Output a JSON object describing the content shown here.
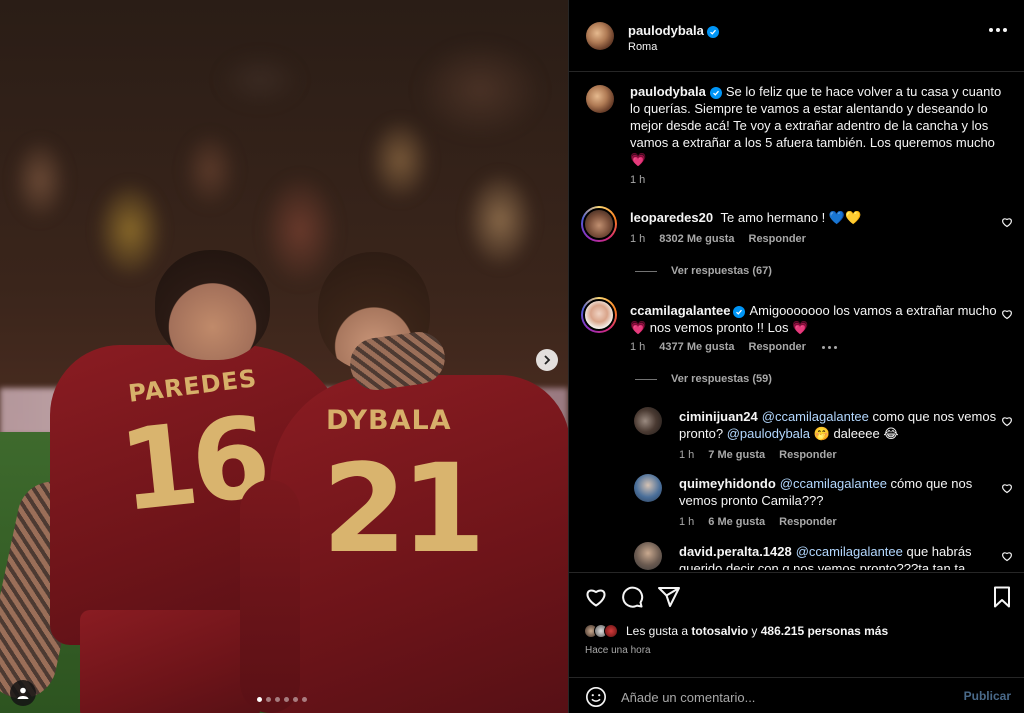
{
  "post": {
    "author": "paulodybala",
    "location": "Roma",
    "carousel": {
      "total": 6,
      "active": 1
    },
    "players": [
      {
        "name": "PAREDES",
        "number": "16"
      },
      {
        "name": "DYBALA",
        "number": "21"
      }
    ]
  },
  "caption": {
    "user": "paulodybala",
    "text": "Se lo feliz que te hace volver a tu casa y cuanto lo querías. Siempre te vamos a estar alentando y deseando lo mejor desde acá! Te voy a extrañar adentro de la cancha y los vamos a extrañar a los 5 afuera también. Los queremos mucho",
    "emoji": "💗",
    "time": "1 h"
  },
  "comments": [
    {
      "user": "leoparedes20",
      "text": "Te amo hermano !",
      "emoji": "💙💛",
      "time": "1 h",
      "likes": "8302 Me gusta",
      "reply_label": "Responder",
      "view_replies": "Ver respuestas (67)"
    },
    {
      "user": "ccamilagalantee",
      "text": "Amigooooooo los vamos a extrañar mucho",
      "text2_prefix": "💗",
      "text2": " nos vemos pronto !! Los ",
      "text2_suffix": "💗",
      "time": "1 h",
      "likes": "4377 Me gusta",
      "reply_label": "Responder",
      "view_replies": "Ver respuestas (59)"
    }
  ],
  "replies": [
    {
      "user": "ciminijuan24",
      "mention1": "@ccamilagalantee",
      "text1": " como que nos vemos",
      "text2": "pronto? ",
      "mention2": "@paulodybala",
      "text3": " 🤭 daleeee 😂",
      "time": "1 h",
      "likes": "7 Me gusta",
      "reply_label": "Responder"
    },
    {
      "user": "quimeyhidondo",
      "mention1": "@ccamilagalantee",
      "text1": " cómo que nos",
      "text2": "vemos pronto Camila???",
      "time": "1 h",
      "likes": "6 Me gusta",
      "reply_label": "Responder"
    },
    {
      "user": "david.peralta.1428",
      "mention1": "@ccamilagalantee",
      "text1": " que habrás",
      "text2": "querido decir con q nos vemos pronto???ta tan ta"
    }
  ],
  "footer": {
    "likes_prefix": "Les gusta a ",
    "likes_user": "totosalvio",
    "likes_mid": " y ",
    "likes_count": "486.215 personas más",
    "time_ago": "Hace una hora",
    "comment_placeholder": "Añade un comentario...",
    "publish_label": "Publicar"
  },
  "colors": {
    "verified": "#0095f6",
    "jersey": "#7a181d",
    "jersey_text": "#d7b06a"
  }
}
